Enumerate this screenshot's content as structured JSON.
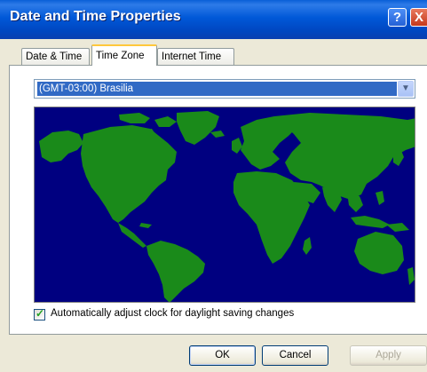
{
  "window": {
    "title": "Date and Time Properties",
    "help_glyph": "?",
    "close_glyph": "X"
  },
  "tabs": [
    {
      "label": "Date & Time",
      "active": false
    },
    {
      "label": "Time Zone",
      "active": true
    },
    {
      "label": "Internet Time",
      "active": false
    }
  ],
  "timezone": {
    "selected": "(GMT-03:00) Brasilia",
    "dropdown_glyph": "▼"
  },
  "map": {
    "ocean_color": "#000080",
    "land_color": "#1A8A1A"
  },
  "daylight": {
    "checked": true,
    "label": "Automatically adjust clock for daylight saving changes"
  },
  "buttons": {
    "ok": "OK",
    "cancel": "Cancel",
    "apply": "Apply"
  }
}
